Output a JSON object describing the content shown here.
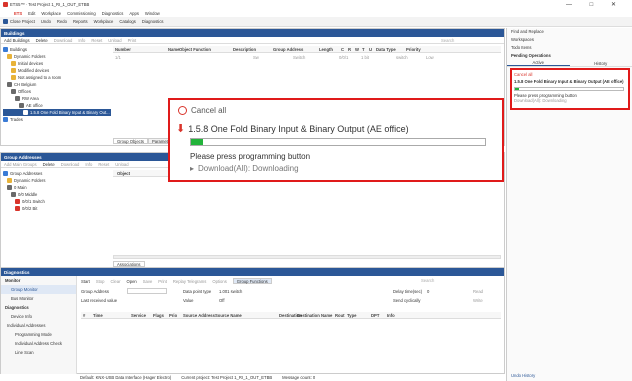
{
  "window": {
    "title": "ETS5™ · Test Project 1_RI_1_OUT_ETBB",
    "menu": [
      "ETS",
      "Edit",
      "Workplace",
      "Commissioning",
      "Diagnostics",
      "Apps",
      "Window"
    ],
    "controls": [
      "—",
      "□",
      "✕"
    ]
  },
  "toolbar": {
    "items": [
      "Close Project",
      "Undo",
      "Redo",
      "Reports",
      "Workplace",
      "Catalogs",
      "Diagnostics"
    ]
  },
  "buildings": {
    "title": "Buildings",
    "actions": [
      "Add Buildings",
      "Delete",
      "Download",
      "Info",
      "Reset",
      "Unload",
      "Print"
    ],
    "search_placeholder": "Search",
    "columns": [
      "Number",
      "Name",
      "Object Function",
      "Description",
      "Group Address",
      "Length",
      "C",
      "R",
      "W",
      "T",
      "U",
      "Data Type",
      "Priority"
    ],
    "rows": [
      {
        "number": "1/1",
        "object_function": "Sw",
        "description": "Switch",
        "group_address": "0/0/1",
        "length": "1 bit",
        "data_type": "switch",
        "priority": "Low"
      }
    ],
    "tree": [
      "Buildings",
      "Dynamic Folders",
      "Initial devices",
      "Modified devices",
      "Not assigned to a room",
      "CH Belgium",
      "Offices",
      "RW Area",
      "AE office",
      "1.5.8 One Fold Binary Input & Binary Out...",
      "Trades"
    ],
    "tabs": [
      "Group Objects",
      "Parameters"
    ]
  },
  "group_addresses": {
    "title": "Group Addresses",
    "actions": [
      "Add Main Groups",
      "Delete",
      "Download",
      "Info",
      "Reset",
      "Unload"
    ],
    "column": "Object",
    "tree": [
      "Group Addresses",
      "Dynamic Folders",
      "0 Main",
      "0/0 Middle",
      "0/0/1 Switch",
      "0/0/2 Bit"
    ],
    "tab": "Associations",
    "right_col": "Des"
  },
  "diagnostics": {
    "title": "Diagnostics",
    "side": [
      "Monitor",
      "Group Monitor",
      "Bus Monitor",
      "Diagnostics",
      "Device Info",
      "Individual Addresses",
      "Programming Mode",
      "Individual Address Check",
      "Line Scan"
    ],
    "tools": [
      "Start",
      "Stop",
      "Clear",
      "Open",
      "Save",
      "Print",
      "Replay Telegrams",
      "Options",
      "Group Functions"
    ],
    "search_placeholder": "Search",
    "labels": {
      "group_address": "Group Address",
      "datapoint_type": "Data point type",
      "dpt_value": "1.001 switch",
      "last_received": "Last received value",
      "value": "Value",
      "value_default": "Off",
      "delay": "Delay time(sec)",
      "delay_value": "0",
      "send_cyclically": "Send cyclically",
      "read": "Read",
      "write": "Write"
    },
    "columns": [
      "#",
      "Time",
      "Service",
      "Flags",
      "Prio",
      "Source Address",
      "Source Name",
      "Destination",
      "Destination Name",
      "Rout",
      "Type",
      "DPT",
      "Info"
    ]
  },
  "status": {
    "interface": "Default: KNX-USB Data Interface (Hager Electro)",
    "project": "Current project: Test Project 1_RI_1_OUT_ETBB",
    "message": "Message count: 0"
  },
  "right_panel": {
    "items": [
      "Find and Replace",
      "Workspaces",
      "Todo Items",
      "Pending Operations"
    ],
    "tabs": [
      "Active",
      "History"
    ],
    "cancel": "Cancel all",
    "device": "1.5.8 One Fold Binary Input & Binary Output  (AE office)",
    "progress": 0.04,
    "message": "Please press programming button",
    "status": "Download(All): Downloading",
    "undo": "Undo History"
  },
  "zoom": {
    "cancel": "Cancel all",
    "device": "1.5.8 One Fold Binary Input & Binary Output  (AE office)",
    "progress": 0.04,
    "message": "Please press programming button",
    "status": "Download(All): Downloading"
  },
  "colors": {
    "accent": "#2b5797",
    "highlight": "#e01a1a",
    "progress": "#22b33a",
    "error": "#d9342b"
  }
}
